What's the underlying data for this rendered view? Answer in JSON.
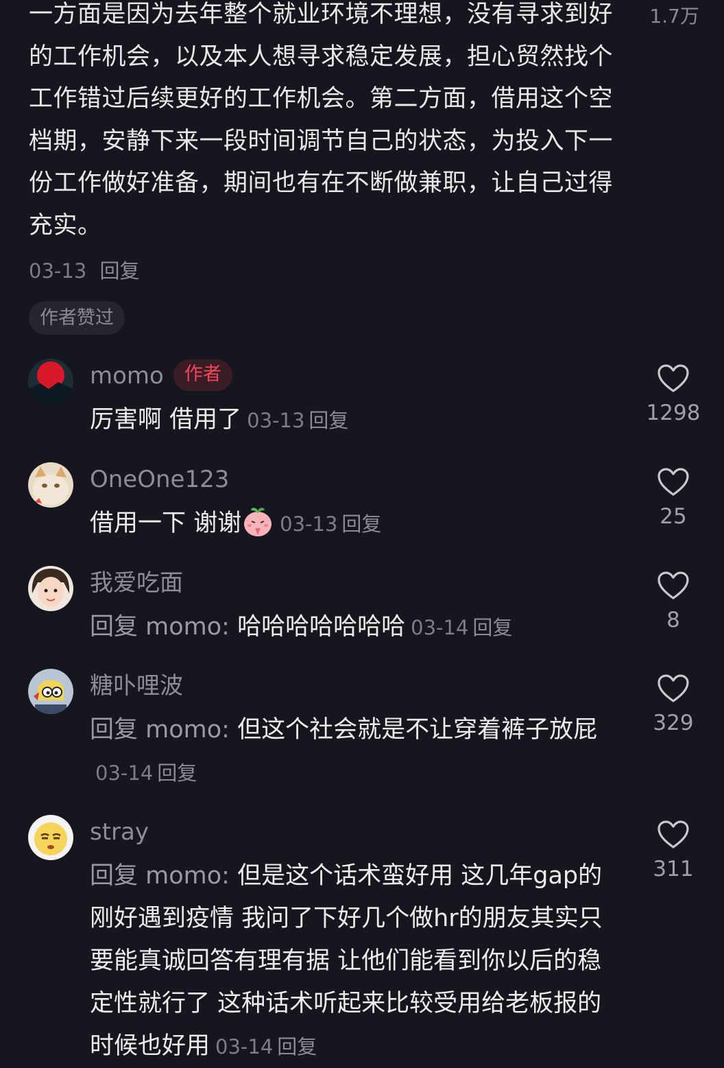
{
  "top_comment": {
    "text": "一方面是因为去年整个就业环境不理想，没有寻求到好的工作机会，以及本人想寻求稳定发展，担心贸然找个工作错过后续更好的工作机会。第二方面，借用这个空档期，安静下来一段时间调节自己的状态，为投入下一份工作做好准备，期间也有在不断做兼职，让自己过得充实。",
    "date": "03-13",
    "reply_label": "回复",
    "likes": "1.7万",
    "author_liked_tag": "作者赞过"
  },
  "comments": [
    {
      "name": "momo",
      "badge": "作者",
      "text": "厉害啊 借用了",
      "date": "03-13",
      "reply_label": "回复",
      "likes": "1298"
    },
    {
      "name": "OneOne123",
      "text": "借用一下 谢谢",
      "date": "03-13",
      "reply_label": "回复",
      "likes": "25"
    },
    {
      "name": "我爱吃面",
      "prefix": "回复",
      "target": "momo:",
      "text": "哈哈哈哈哈哈哈",
      "date": "03-14",
      "reply_label": "回复",
      "likes": "8"
    },
    {
      "name": "糖卟哩波",
      "prefix": "回复",
      "target": "momo:",
      "text": "但这个社会就是不让穿着裤子放屁",
      "date": "03-14",
      "reply_label": "回复",
      "likes": "329"
    },
    {
      "name": "stray",
      "prefix": "回复",
      "target": "momo:",
      "text": "但是这个话术蛮好用 这几年gap的刚好遇到疫情 我问了下好几个做hr的朋友其实只要能真诚回答有理有据 让他们能看到你以后的稳定性就行了 这种话术听起来比较受用给老板报的时候也好用",
      "date": "03-14",
      "reply_label": "回复",
      "likes": "311"
    }
  ],
  "icons": {
    "like": "heart-outline-icon",
    "emoji": "praying-peach-emoji"
  },
  "colors": {
    "background": "#16161e",
    "author_badge": "#f0445f",
    "secondary_text": "#8d8d96"
  }
}
